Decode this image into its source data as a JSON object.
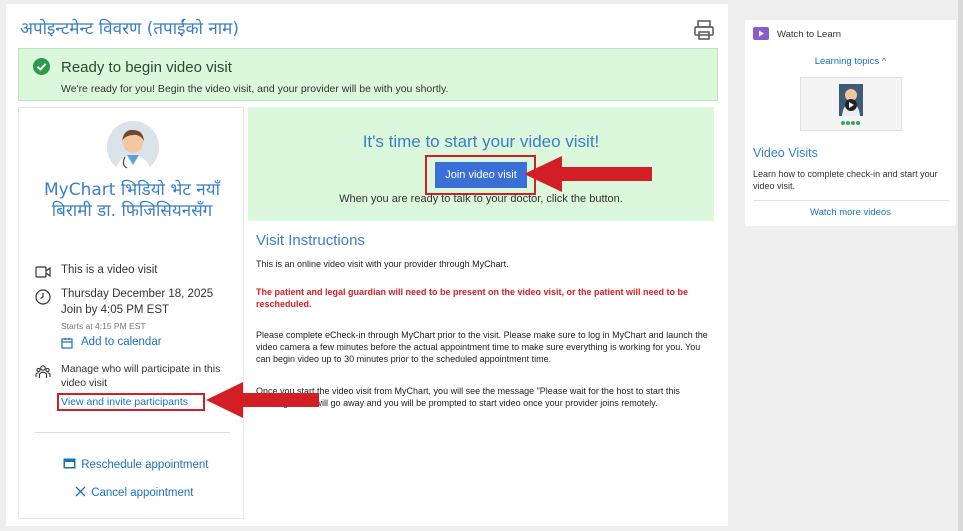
{
  "page": {
    "title": "अपोइन्टमेन्ट विवरण (तपाईंको नाम)"
  },
  "banner": {
    "title": "Ready to begin video visit",
    "text": "We're ready for you! Begin the video visit, and your provider will be with you shortly."
  },
  "provider": {
    "name": "MyChart भिडियो भेट नयाँ बिरामी डा. फिजिसियनसँग",
    "visit_type": "This is a video visit",
    "date": "Thursday December 18, 2025",
    "join_by": "Join by 4:05 PM EST",
    "starts_at": "Starts at 4:15 PM EST",
    "add_calendar": "Add to calendar",
    "manage_line1": "Manage who will participate in this",
    "manage_line2": "video visit",
    "invite_link": "View and invite participants",
    "reschedule": "Reschedule appointment",
    "cancel": "Cancel appointment"
  },
  "video": {
    "heading": "It's time to start your video visit!",
    "join_button": "Join video visit",
    "subtext": "When you are ready to talk to your doctor, click the button."
  },
  "instructions": {
    "title": "Visit Instructions",
    "p1": "This is an online video visit with your provider through MyChart.",
    "p2": "The patient and legal guardian will need to be present on the video visit, or the patient will need to be rescheduled.",
    "p3": "Please complete eCheck-in through MyChart prior to the visit. Please make sure to log in MyChart and launch the video camera a few minutes before the actual appointment time to make sure everything is working for you. You can begin video up to 30 minutes prior to the scheduled appointment time.",
    "p4": "Once you start the video visit from MyChart, you will see the message \"Please wait for the host to start this meeting.\" This will go away and you will be prompted to start video once your provider joins remotely."
  },
  "sidebar": {
    "watch_label": "Watch to Learn",
    "learning_topics": "Learning topics ^",
    "video_title": "Video Visits",
    "video_desc": "Learn how to complete check-in and start your video visit.",
    "watch_more": "Watch more videos"
  },
  "colors": {
    "accent_blue": "#3b7fc4",
    "success_green": "#dbf7dc",
    "button_blue": "#3a6fd8",
    "highlight_red": "#d21e24"
  },
  "icons": [
    "printer-icon",
    "check-circle-icon",
    "video-camera-icon",
    "clock-icon",
    "calendar-icon",
    "participants-icon",
    "reschedule-icon",
    "close-icon",
    "watch-video-icon",
    "play-icon"
  ]
}
